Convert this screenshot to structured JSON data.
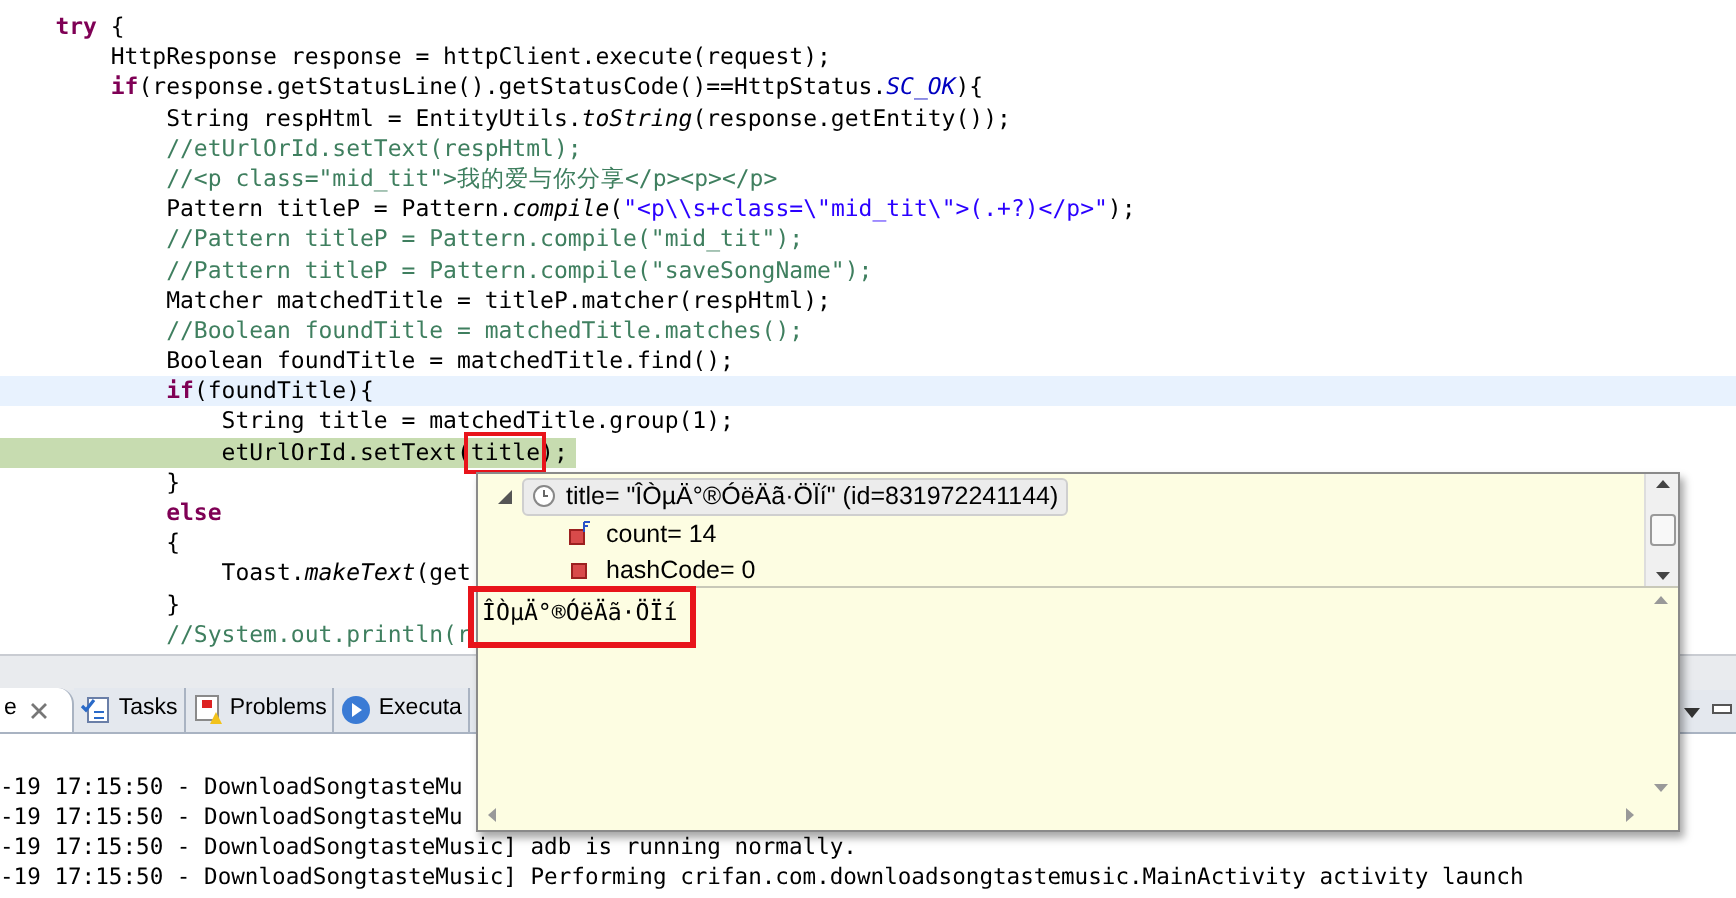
{
  "editor": {
    "lines": [
      {
        "kind": "plain",
        "segments": [
          {
            "kind": "keyword",
            "text": "    try"
          },
          {
            "kind": "plain",
            "text": " {"
          }
        ]
      },
      {
        "kind": "plain",
        "segments": [
          {
            "kind": "plain",
            "text": "        HttpResponse response = httpClient.execute(request);"
          }
        ]
      },
      {
        "kind": "plain",
        "segments": [
          {
            "kind": "keyword",
            "text": "        if"
          },
          {
            "kind": "plain",
            "text": "(response.getStatusLine().getStatusCode()==HttpStatus."
          },
          {
            "kind": "static",
            "text": "SC_OK"
          },
          {
            "kind": "plain",
            "text": "){"
          }
        ]
      },
      {
        "kind": "plain",
        "segments": [
          {
            "kind": "plain",
            "text": "            String respHtml = EntityUtils."
          },
          {
            "kind": "italic",
            "text": "toString"
          },
          {
            "kind": "plain",
            "text": "(response.getEntity());"
          }
        ]
      },
      {
        "kind": "plain",
        "segments": [
          {
            "kind": "comment",
            "text": "            //etUrlOrId.setText(respHtml);"
          }
        ]
      },
      {
        "kind": "plain",
        "segments": [
          {
            "kind": "comment",
            "text": "            //<p class=\"mid_tit\">我的爱与你分享</p><p></p>"
          }
        ]
      },
      {
        "kind": "plain",
        "segments": [
          {
            "kind": "plain",
            "text": "            Pattern titleP = Pattern."
          },
          {
            "kind": "italic",
            "text": "compile"
          },
          {
            "kind": "plain",
            "text": "("
          },
          {
            "kind": "string",
            "text": "\"<p\\\\s+class=\\\"mid_tit\\\">(.+?)</p>\""
          },
          {
            "kind": "plain",
            "text": ");"
          }
        ]
      },
      {
        "kind": "plain",
        "segments": [
          {
            "kind": "comment",
            "text": "            //Pattern titleP = Pattern.compile(\"mid_tit\");"
          }
        ]
      },
      {
        "kind": "plain",
        "segments": [
          {
            "kind": "comment",
            "text": "            //Pattern titleP = Pattern.compile(\"saveSongName\");"
          }
        ]
      },
      {
        "kind": "plain",
        "segments": [
          {
            "kind": "plain",
            "text": "            Matcher matchedTitle = titleP.matcher(respHtml);"
          }
        ]
      },
      {
        "kind": "plain",
        "segments": [
          {
            "kind": "comment",
            "text": "            //Boolean foundTitle = matchedTitle.matches();"
          }
        ]
      },
      {
        "kind": "plain",
        "segments": [
          {
            "kind": "plain",
            "text": "            Boolean foundTitle = matchedTitle.find();"
          }
        ]
      },
      {
        "kind": "cursor",
        "segments": [
          {
            "kind": "keyword",
            "text": "            if"
          },
          {
            "kind": "plain",
            "text": "(foundTitle){"
          }
        ]
      },
      {
        "kind": "plain",
        "segments": [
          {
            "kind": "plain",
            "text": "                String title = matchedTitle.group(1);"
          }
        ]
      },
      {
        "kind": "execution",
        "segments": [
          {
            "kind": "plain",
            "text": "                etUrlOrId.setText("
          },
          {
            "kind": "framed",
            "text": "title"
          },
          {
            "kind": "plain",
            "text": ");"
          }
        ]
      },
      {
        "kind": "plain",
        "segments": [
          {
            "kind": "plain",
            "text": "            }"
          }
        ]
      },
      {
        "kind": "plain",
        "segments": [
          {
            "kind": "keyword",
            "text": "            else"
          }
        ]
      },
      {
        "kind": "plain",
        "segments": [
          {
            "kind": "plain",
            "text": "            {"
          }
        ]
      },
      {
        "kind": "plain",
        "segments": [
          {
            "kind": "plain",
            "text": "                Toast."
          },
          {
            "kind": "italic",
            "text": "makeText"
          },
          {
            "kind": "plain",
            "text": "(get"
          }
        ]
      },
      {
        "kind": "plain",
        "segments": [
          {
            "kind": "plain",
            "text": "            }"
          }
        ]
      },
      {
        "kind": "plain",
        "segments": [
          {
            "kind": "comment",
            "text": "            //System.out.println(r"
          }
        ]
      }
    ]
  },
  "hover_popup": {
    "tree": [
      {
        "label": "title= \"ÎÒµÄ°®ÓëÄã·ÖÏí\" (id=831972241144)",
        "selected": true,
        "expanded": true,
        "children": [
          {
            "label": "count= 14",
            "selected": false,
            "kind": "final_field"
          },
          {
            "label": "hashCode= 0",
            "selected": false,
            "kind": "field"
          }
        ]
      }
    ],
    "detail": {
      "text": "ÎÒµÄ°®ÓëÄã·ÖÏí",
      "framed": true
    }
  },
  "bottom_panel": {
    "tabs": [
      {
        "label": "e",
        "selected": true,
        "closable": true,
        "kind": "console"
      },
      {
        "label": "Tasks",
        "selected": false,
        "closable": false,
        "kind": "tasks"
      },
      {
        "label": "Problems",
        "selected": false,
        "closable": false,
        "kind": "problems"
      },
      {
        "label": "Executa",
        "selected": false,
        "closable": false,
        "kind": "run"
      }
    ],
    "console_lines": [
      "-19 17:15:50 - DownloadSongtasteMu",
      "-19 17:15:50 - DownloadSongtasteMu",
      "-19 17:15:50 - DownloadSongtasteMusic] adb is running normally.",
      "-19 17:15:50 - DownloadSongtasteMusic] Performing crifan.com.downloadsongtastemusic.MainActivity activity launch"
    ]
  }
}
